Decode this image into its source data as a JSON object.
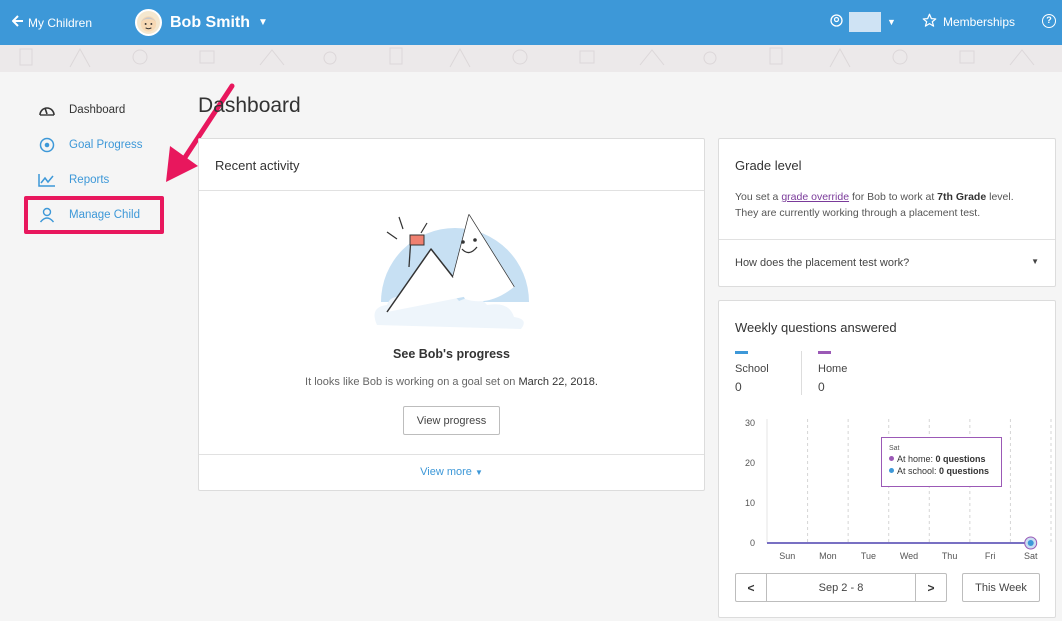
{
  "header": {
    "back_label": "My Children",
    "child_name": "Bob Smith",
    "memberships_label": "Memberships",
    "help_label": "?"
  },
  "sidebar": {
    "items": [
      {
        "label": "Dashboard",
        "icon": "speedometer-icon",
        "active": true
      },
      {
        "label": "Goal Progress",
        "icon": "target-icon",
        "active": false
      },
      {
        "label": "Reports",
        "icon": "chart-icon",
        "active": false
      },
      {
        "label": "Manage Child",
        "icon": "person-icon",
        "active": false
      }
    ]
  },
  "page_title": "Dashboard",
  "recent_activity": {
    "title": "Recent activity",
    "heading": "See Bob's progress",
    "description_prefix": "It looks like Bob is working on a goal set on ",
    "description_date": "March 22, 2018.",
    "button_label": "View progress",
    "view_more_label": "View more"
  },
  "grade_level": {
    "title": "Grade level",
    "line1_a": "You set a ",
    "line1_link": "grade override",
    "line1_b": " for Bob to work at ",
    "line1_grade": "7th Grade",
    "line1_c": " level.",
    "line2": "They are currently working through a placement test.",
    "faq_label": "How does the placement test work?"
  },
  "weekly": {
    "title": "Weekly questions answered",
    "legend": [
      {
        "name": "School",
        "value": "0",
        "color": "#3d98d8"
      },
      {
        "name": "Home",
        "value": "0",
        "color": "#9b59b6"
      }
    ],
    "tooltip": {
      "day": "Sat",
      "home_label": "At home: ",
      "home_value": "0 questions",
      "school_label": "At school: ",
      "school_value": "0 questions"
    },
    "range_label": "Sep 2 - 8",
    "prev_label": "<",
    "next_label": ">",
    "this_week_label": "This Week"
  },
  "chart_data": {
    "type": "line",
    "categories": [
      "Sun",
      "Mon",
      "Tue",
      "Wed",
      "Thu",
      "Fri",
      "Sat"
    ],
    "series": [
      {
        "name": "School",
        "values": [
          0,
          0,
          0,
          0,
          0,
          0,
          0
        ],
        "color": "#3d98d8"
      },
      {
        "name": "Home",
        "values": [
          0,
          0,
          0,
          0,
          0,
          0,
          0
        ],
        "color": "#9b59b6"
      }
    ],
    "yticks": [
      0,
      10,
      20,
      30
    ],
    "ylim": [
      0,
      30
    ]
  }
}
